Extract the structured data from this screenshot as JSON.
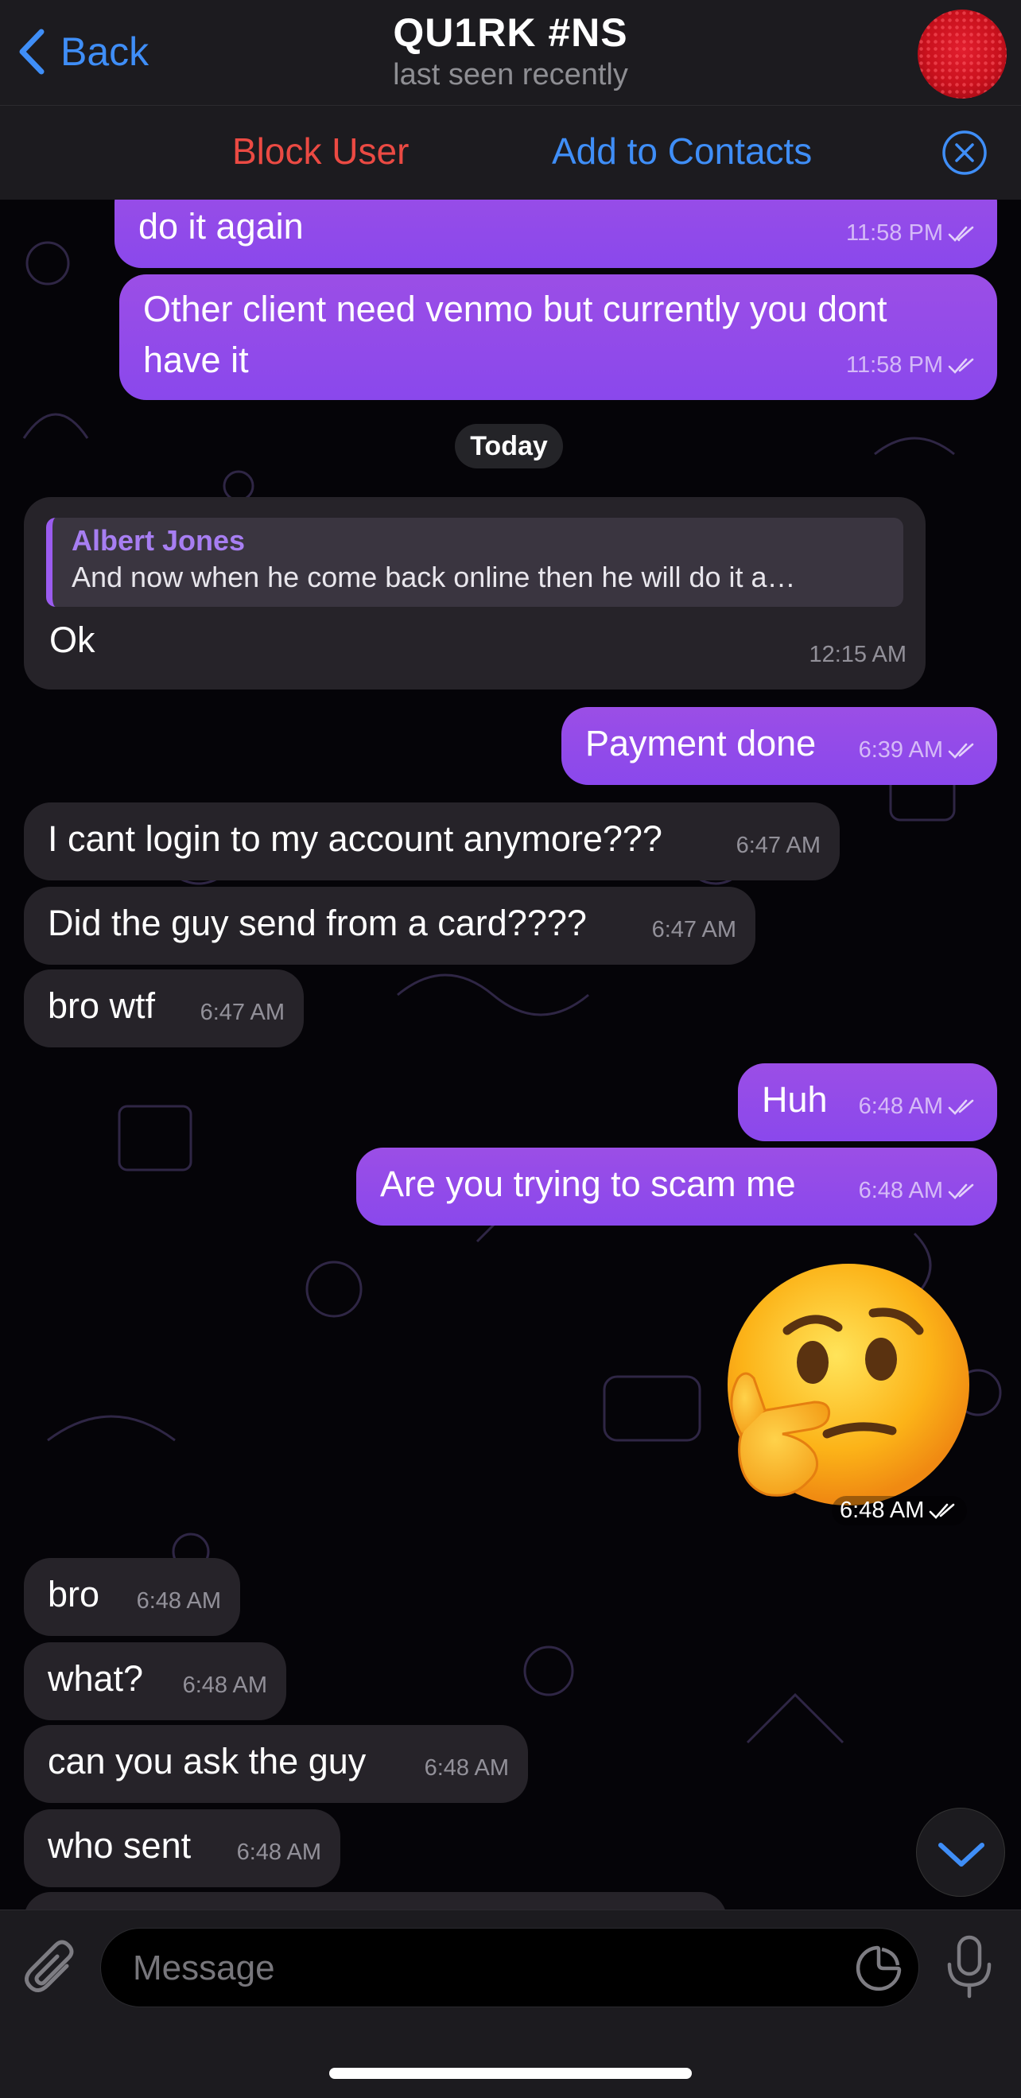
{
  "header": {
    "back_label": "Back",
    "title": "QU1RK #NS",
    "status": "last seen recently"
  },
  "actions": {
    "block_label": "Block User",
    "add_contacts_label": "Add to Contacts"
  },
  "colors": {
    "accent_blue": "#3f8ef7",
    "destructive_red": "#eb4a43",
    "outgoing_bubble": "#8b4be8",
    "incoming_bubble": "#262329"
  },
  "messages": [
    {
      "id": "m1",
      "dir": "out",
      "text": "do it again",
      "time": "11:58 PM",
      "read": true
    },
    {
      "id": "m2",
      "dir": "out",
      "text": "Other client need venmo but currently you dont have it",
      "time": "11:58 PM",
      "read": true
    },
    {
      "id": "m3",
      "dir": "in",
      "reply_name": "Albert Jones",
      "reply_text": "And now when he come back online then he will do it a…",
      "text": "Ok",
      "time": "12:15 AM"
    },
    {
      "id": "m4",
      "dir": "out",
      "text": "Payment done",
      "time": "6:39 AM",
      "read": true
    },
    {
      "id": "m5",
      "dir": "in",
      "text": "I cant login to my account anymore???",
      "time": "6:47 AM"
    },
    {
      "id": "m6",
      "dir": "in",
      "text": "Did the guy send from a card????",
      "time": "6:47 AM"
    },
    {
      "id": "m7",
      "dir": "in",
      "text": "bro wtf",
      "time": "6:47 AM"
    },
    {
      "id": "m8",
      "dir": "out",
      "text": "Huh",
      "time": "6:48 AM",
      "read": true
    },
    {
      "id": "m9",
      "dir": "out",
      "text": "Are you trying to scam me",
      "time": "6:48 AM",
      "read": true
    },
    {
      "id": "m10",
      "dir": "out",
      "sticker": "thinking-face-emoji",
      "time": "6:48 AM",
      "read": true
    },
    {
      "id": "m11",
      "dir": "in",
      "text": "bro",
      "time": "6:48 AM"
    },
    {
      "id": "m12",
      "dir": "in",
      "text": "what?",
      "time": "6:48 AM"
    },
    {
      "id": "m13",
      "dir": "in",
      "text": "can you ask the guy",
      "time": "6:48 AM"
    },
    {
      "id": "m14",
      "dir": "in",
      "text": "who sent",
      "time": "6:48 AM"
    }
  ],
  "date_separator": "Today",
  "composer": {
    "placeholder": "Message"
  },
  "icons": {
    "back": "chevron-left-icon",
    "close": "close-circle-icon",
    "attach": "paperclip-icon",
    "sticker": "sticker-icon",
    "mic": "microphone-icon",
    "scroll_down": "chevron-down-icon"
  }
}
